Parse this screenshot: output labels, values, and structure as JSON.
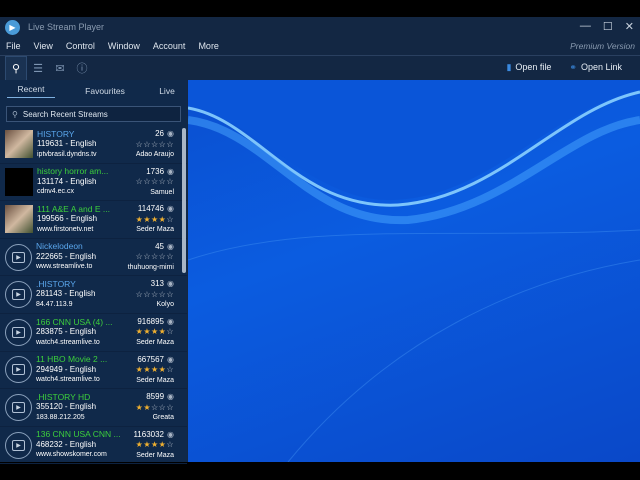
{
  "window": {
    "title": "Live Stream Player",
    "minimize": "—",
    "maximize": "☐",
    "close": "✕"
  },
  "menu": [
    "File",
    "View",
    "Control",
    "Window",
    "Account",
    "More"
  ],
  "edition": "Premium Version",
  "toolbar": {
    "open_file": "Open file",
    "open_link": "Open Link"
  },
  "tabs": [
    "Recent",
    "Favourites",
    "Live"
  ],
  "search": {
    "placeholder": "Search Recent Streams"
  },
  "colors": {
    "blue_name": "#5aa6ec",
    "green_name": "#3ccf3c",
    "star": "#f0b030"
  },
  "streams": [
    {
      "name": "HISTORY",
      "id": "119631 - English",
      "url": "iptvbrasil.dyndns.tv",
      "views": "26",
      "rating": 0,
      "user": "Adao Araujo",
      "color": "blue",
      "thumb": "history"
    },
    {
      "name": "history horror am...",
      "id": "131174 - English",
      "url": "cdnv4.ec.cx",
      "views": "1736",
      "rating": 0,
      "user": "Samuel",
      "color": "green",
      "thumb": "black"
    },
    {
      "name": "111 A&E A and E  ...",
      "id": "199566 - English",
      "url": "www.firstonetv.net",
      "views": "114746",
      "rating": 4,
      "user": "Seder Maza",
      "color": "green",
      "thumb": "ae"
    },
    {
      "name": "Nickelodeon",
      "id": "222665 - English",
      "url": "www.streamlive.to",
      "views": "45",
      "rating": 0,
      "user": "thuhuong-mimi",
      "color": "blue",
      "thumb": "play"
    },
    {
      "name": ".HISTORY",
      "id": "281143 - English",
      "url": "84.47.113.9",
      "views": "313",
      "rating": 0,
      "user": "Kolyo",
      "color": "blue",
      "thumb": "play"
    },
    {
      "name": "166 CNN USA (4)  ...",
      "id": "283875 - English",
      "url": "watch4.streamlive.to",
      "views": "916895",
      "rating": 4,
      "user": "Seder Maza",
      "color": "green",
      "thumb": "play"
    },
    {
      "name": "11 HBO Movie 2  ...",
      "id": "294949 - English",
      "url": "watch4.streamlive.to",
      "views": "667567",
      "rating": 4,
      "user": "Seder Maza",
      "color": "green",
      "thumb": "play"
    },
    {
      "name": ".HISTORY HD",
      "id": "355120 - English",
      "url": "183.88.212.205",
      "views": "8599",
      "rating": 2,
      "user": "Greata",
      "color": "green",
      "thumb": "play"
    },
    {
      "name": "136 CNN USA  CNN ...",
      "id": "468232 - English",
      "url": "www.showskomer.com",
      "views": "1163032",
      "rating": 4,
      "user": "Seder Maza",
      "color": "green",
      "thumb": "play"
    }
  ]
}
